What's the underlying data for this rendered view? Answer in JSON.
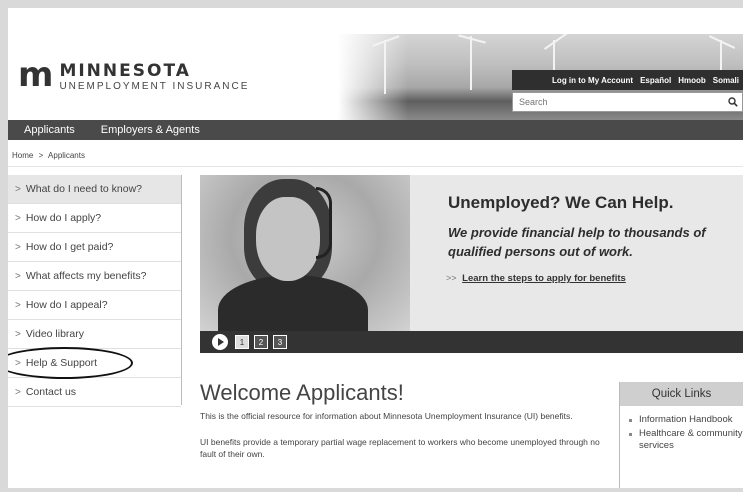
{
  "header": {
    "logo_mark": "m",
    "logo_state": "MINNESOTA",
    "logo_sub": "UNEMPLOYMENT INSURANCE",
    "top_links": [
      "Log in to My Account",
      "Español",
      "Hmoob",
      "Somali"
    ],
    "search_placeholder": "Search"
  },
  "nav": {
    "items": [
      "Applicants",
      "Employers & Agents"
    ]
  },
  "breadcrumb": {
    "home": "Home",
    "separator": ">",
    "current": "Applicants"
  },
  "sidebar": {
    "items": [
      {
        "label": "What do I need to know?"
      },
      {
        "label": "How do I apply?"
      },
      {
        "label": "How do I get paid?"
      },
      {
        "label": "What affects my benefits?"
      },
      {
        "label": "How do I appeal?"
      },
      {
        "label": "Video library"
      },
      {
        "label": "Help & Support"
      },
      {
        "label": "Contact us"
      }
    ],
    "chevron": ">"
  },
  "carousel": {
    "title": "Unemployed? We Can Help.",
    "body": "We provide financial help to thousands of qualified persons out of work.",
    "link_prefix": ">>",
    "link_text": "Learn the steps to apply for benefits",
    "pages": [
      "1",
      "2",
      "3"
    ],
    "active_page": "1"
  },
  "welcome": {
    "title": "Welcome Applicants!",
    "p1": "This is the official resource for information about Minnesota Unemployment Insurance (UI) benefits.",
    "p2": "UI benefits provide a temporary partial wage replacement to workers who become unemployed through no fault of their own."
  },
  "quick_links": {
    "title": "Quick Links",
    "items": [
      "Information Handbook",
      "Healthcare & community services"
    ]
  },
  "colors": {
    "nav": "#4a4a4a",
    "topbar": "#2f2f2f",
    "carousel_bar": "#333333"
  }
}
